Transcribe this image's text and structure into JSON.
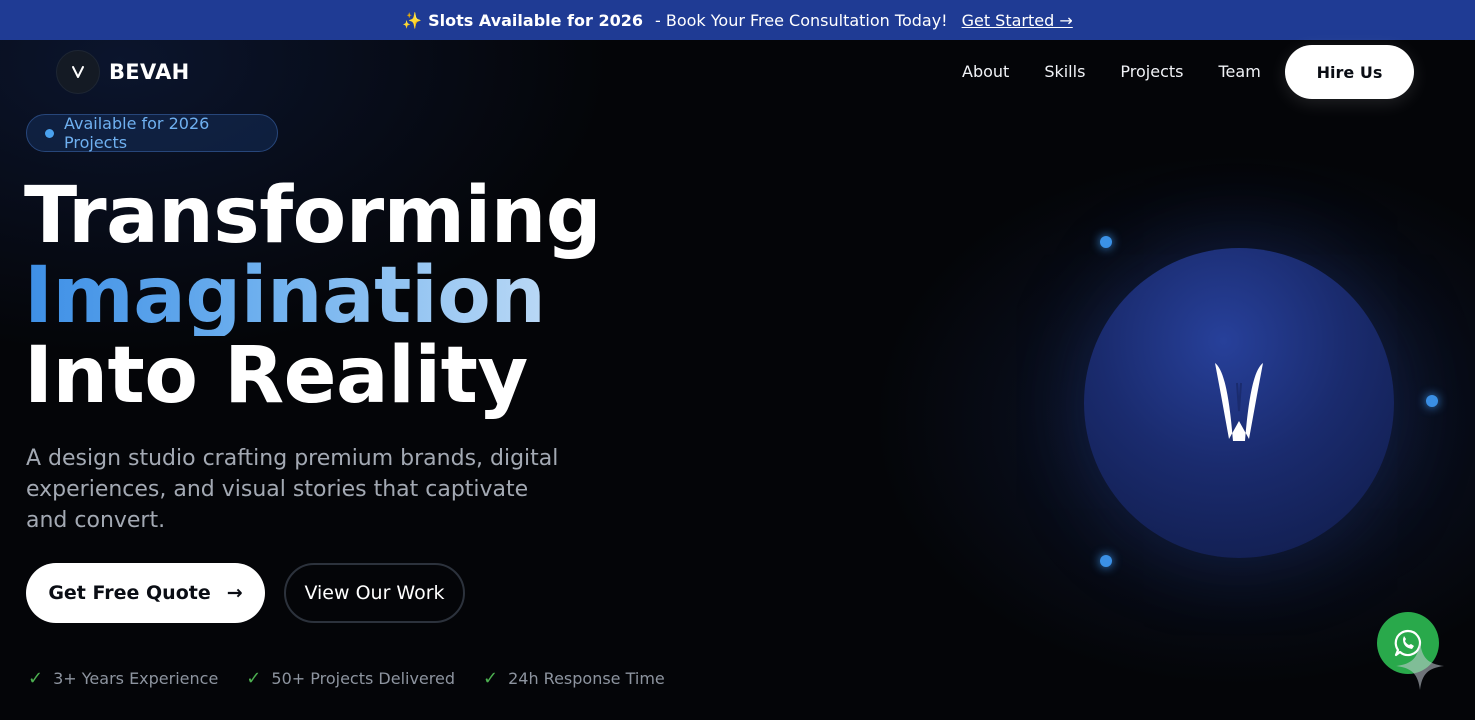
{
  "announcement": {
    "sparkle": "✨",
    "highlight": "Slots Available for 2026",
    "text": "- Book Your Free Consultation Today!",
    "link": "Get Started →"
  },
  "nav": {
    "logo_mark": "V",
    "brand": "BEVAH",
    "links": [
      "About",
      "Skills",
      "Projects",
      "Team"
    ],
    "cta": "Hire Us"
  },
  "hero": {
    "badge": "Available for 2026 Projects",
    "headline": {
      "line1": "Transforming",
      "line2": "Imagination",
      "line3": "Into Reality"
    },
    "subtitle": "A design studio crafting premium brands, digital experiences, and visual stories that captivate and convert.",
    "primary_cta": "Get Free Quote",
    "primary_cta_arrow": "→",
    "secondary_cta": "View Our Work",
    "stats": [
      "3+ Years Experience",
      "50+ Projects Delivered",
      "24h Response Time"
    ]
  },
  "colors": {
    "announcement_bg": "#1f3b94",
    "accent_blue": "#3c93e8",
    "whatsapp_green": "#29a94b",
    "check_green": "#4caf50"
  },
  "icons": {
    "whatsapp": "whatsapp-icon",
    "check": "check-icon",
    "orb_logo": "v-logo-icon"
  }
}
